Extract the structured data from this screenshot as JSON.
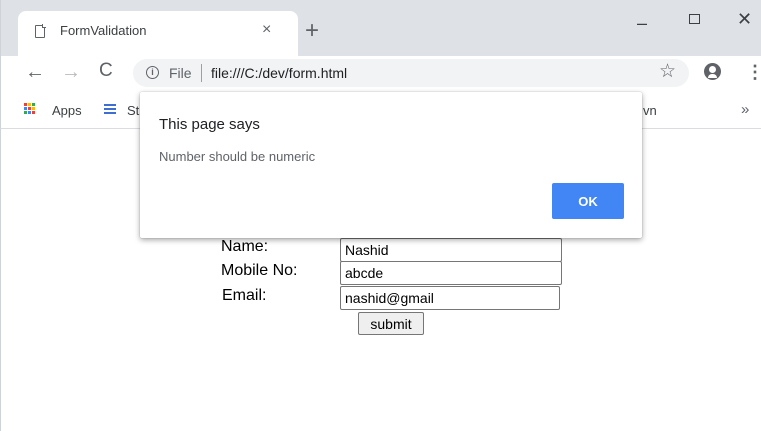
{
  "browser": {
    "tab_title": "FormValidation",
    "tab_close": "×",
    "new_tab": "+",
    "window": {
      "minimize": "–",
      "close": "✕"
    },
    "nav": {
      "back": "←",
      "forward": "→",
      "reload": "C"
    },
    "omnibox": {
      "security_chip": "File",
      "url": "file:///C:/dev/form.html",
      "star": "☆",
      "menu": "⋮"
    },
    "bookmarks": {
      "apps": "Apps",
      "item1": "St",
      "item2": "vn",
      "more": "»"
    }
  },
  "form": {
    "name_label": "Name:",
    "mobile_label": "Mobile No:",
    "email_label": "Email:",
    "name_value": "Nashid",
    "mobile_value": "abcde",
    "email_value": "nashid@gmail",
    "submit_label": "submit"
  },
  "dialog": {
    "title": "This page says",
    "message": "Number should be numeric",
    "ok_label": "OK",
    "ok_color": "#4285f4"
  }
}
